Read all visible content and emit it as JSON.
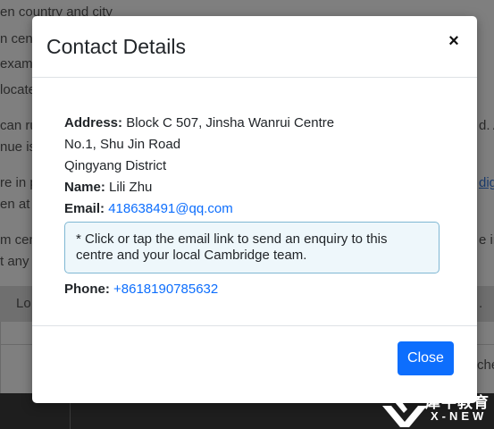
{
  "background": {
    "lines": [
      "en country and city",
      "n centr",
      "exam",
      "locate",
      "can ru",
      "nue is",
      "re in p",
      "en at a",
      "m cen",
      "t any p"
    ],
    "right_fragments": [
      "d. A",
      "dig",
      "e in",
      "."
    ],
    "band_text": "Lo",
    "row_fragment": "che"
  },
  "modal": {
    "title": "Contact Details",
    "close_icon_glyph": "×",
    "address_label": "Address:",
    "address_line1": "Block C 507, Jinsha Wanrui Centre",
    "address_line2": "No.1, Shu Jin Road",
    "address_line3": "Qingyang District",
    "name_label": "Name:",
    "name_value": "Lili Zhu",
    "email_label": "Email:",
    "email_value": "418638491@qq.com",
    "note": "* Click or tap the email link to send an enquiry to this centre and your local Cambridge team.",
    "phone_label": "Phone:",
    "phone_value": "+8618190785632",
    "close_button": "Close"
  },
  "watermark": {
    "chinese": "犀牛教育",
    "english": "X-NEW"
  },
  "colors": {
    "primary": "#0d6efd",
    "note_bg": "#eef7fb",
    "note_border": "#7fb7d3",
    "overlay": "#7f7f7f"
  }
}
